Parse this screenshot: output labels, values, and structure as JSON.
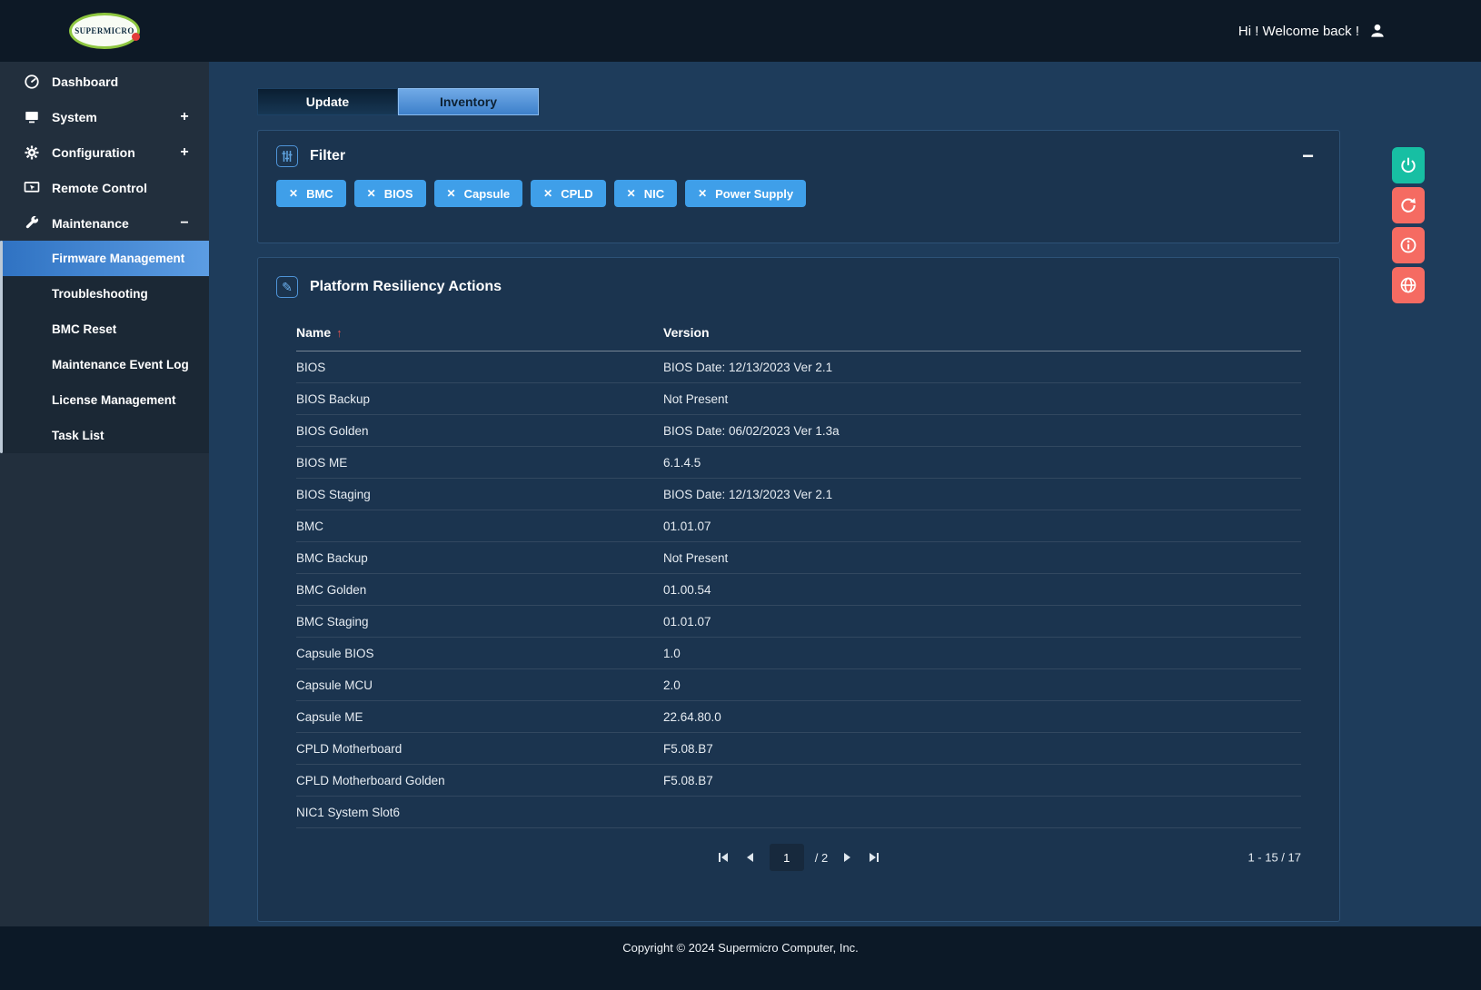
{
  "colors": {
    "accent_blue": "#3f9fe9",
    "active_item_blue": "#4a8fd6",
    "active_tab_blue": "#4d92d8",
    "power_button_teal": "#17bfa3",
    "action_button_red": "#f56b62",
    "sort_arrow_red": "#e0524e",
    "logo_green": "#8dc63f",
    "logo_dot_red": "#e23b3b",
    "panel_background": "#1b344f",
    "main_background": "#1e3c5b"
  },
  "icons": {
    "close_x": "✕",
    "collapse_minus": "−",
    "sort_asc": "↑",
    "pencil": "✎"
  },
  "header": {
    "logo": "SUPERMICRO",
    "welcome": "Hi ! Welcome back !"
  },
  "sidebar": {
    "items": [
      {
        "label": "Dashboard",
        "toggle": ""
      },
      {
        "label": "System",
        "toggle": "+"
      },
      {
        "label": "Configuration",
        "toggle": "+"
      },
      {
        "label": "Remote Control",
        "toggle": ""
      },
      {
        "label": "Maintenance",
        "toggle": "−"
      }
    ],
    "submenu": [
      {
        "label": "Firmware Management"
      },
      {
        "label": "Troubleshooting"
      },
      {
        "label": "BMC Reset"
      },
      {
        "label": "Maintenance Event Log"
      },
      {
        "label": "License Management"
      },
      {
        "label": "Task List"
      }
    ]
  },
  "tabs": {
    "update": "Update",
    "inventory": "Inventory"
  },
  "filter": {
    "title": "Filter",
    "chips": [
      {
        "label": "BMC"
      },
      {
        "label": "BIOS"
      },
      {
        "label": "Capsule"
      },
      {
        "label": "CPLD"
      },
      {
        "label": "NIC"
      },
      {
        "label": "Power Supply"
      }
    ]
  },
  "panel": {
    "title": "Platform Resiliency Actions"
  },
  "table": {
    "columns": [
      "Name",
      "Version"
    ],
    "rows": [
      {
        "name": "BIOS",
        "version": "BIOS Date: 12/13/2023 Ver 2.1"
      },
      {
        "name": "BIOS Backup",
        "version": "Not Present"
      },
      {
        "name": "BIOS Golden",
        "version": "BIOS Date: 06/02/2023 Ver 1.3a"
      },
      {
        "name": "BIOS ME",
        "version": "6.1.4.5"
      },
      {
        "name": "BIOS Staging",
        "version": "BIOS Date: 12/13/2023 Ver 2.1"
      },
      {
        "name": "BMC",
        "version": "01.01.07"
      },
      {
        "name": "BMC Backup",
        "version": "Not Present"
      },
      {
        "name": "BMC Golden",
        "version": "01.00.54"
      },
      {
        "name": "BMC Staging",
        "version": "01.01.07"
      },
      {
        "name": "Capsule BIOS",
        "version": "1.0"
      },
      {
        "name": "Capsule MCU",
        "version": "2.0"
      },
      {
        "name": "Capsule ME",
        "version": "22.64.80.0"
      },
      {
        "name": "CPLD Motherboard",
        "version": "F5.08.B7"
      },
      {
        "name": "CPLD Motherboard Golden",
        "version": "F5.08.B7"
      },
      {
        "name": "NIC1 System Slot6",
        "version": ""
      }
    ]
  },
  "pagination": {
    "current": "1",
    "total": "/ 2",
    "range": "1 - 15 / 17"
  },
  "footer": {
    "copyright": "Copyright © 2024 Supermicro Computer, Inc."
  }
}
